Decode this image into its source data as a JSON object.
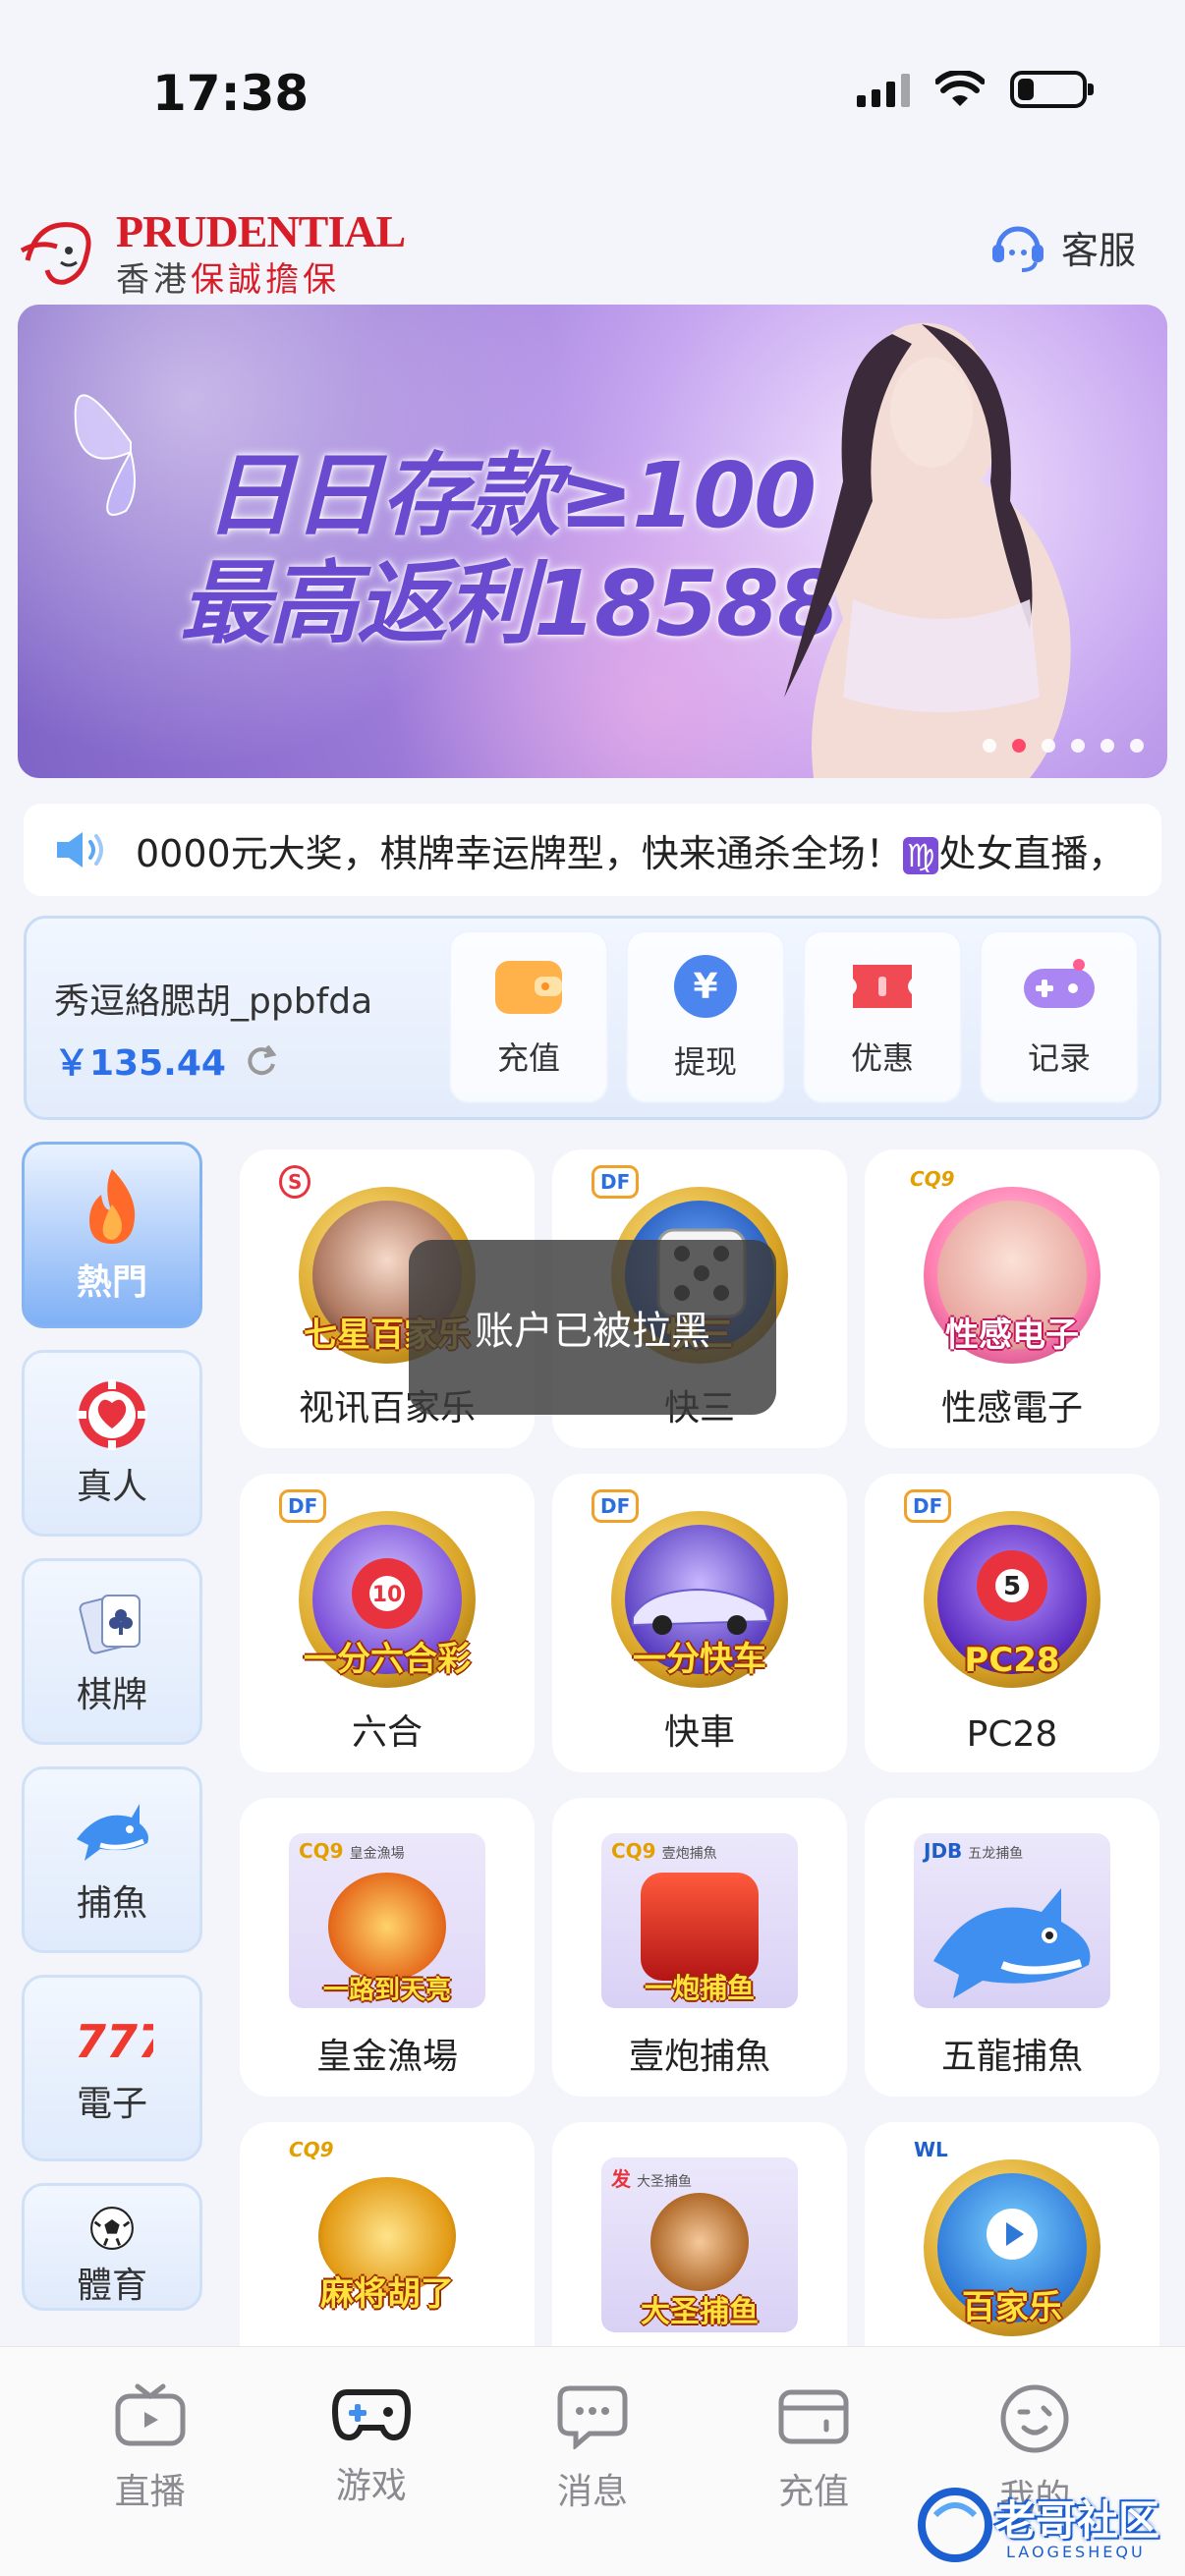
{
  "status_bar": {
    "time": "17:38"
  },
  "header": {
    "logo_brand": "PRUDENTIAL",
    "logo_sub_a": "香港",
    "logo_sub_b": "保誠擔保",
    "service_label": "客服"
  },
  "banner": {
    "line1": "日日存款≥100",
    "line2": "最高返利18588",
    "slide_count": 6,
    "active_slide": 2
  },
  "marquee": {
    "text": "0000元大奖，棋牌幸运牌型，快来通杀全场！",
    "virgo": "♍",
    "tail": "处女直播，"
  },
  "account": {
    "username": "秀逗絡腮胡_ppbfda",
    "balance": "￥135.44",
    "actions": [
      {
        "label": "充值",
        "icon": "wallet-icon"
      },
      {
        "label": "提现",
        "icon": "yuan-coin-icon"
      },
      {
        "label": "优惠",
        "icon": "ticket-icon"
      },
      {
        "label": "记录",
        "icon": "gamepad-icon"
      }
    ]
  },
  "side_nav": [
    {
      "label": "熱門",
      "icon": "flame-icon",
      "active": true
    },
    {
      "label": "真人",
      "icon": "poker-chip-icon",
      "active": false
    },
    {
      "label": "棋牌",
      "icon": "playing-cards-icon",
      "active": false
    },
    {
      "label": "捕魚",
      "icon": "shark-icon",
      "active": false
    },
    {
      "label": "電子",
      "icon": "slot-777-icon",
      "active": false
    },
    {
      "label": "體育",
      "icon": "soccer-ball-icon",
      "active": false
    }
  ],
  "games": [
    {
      "label": "视讯百家乐",
      "art_text": "七星百家乐",
      "badge": "S"
    },
    {
      "label": "快三",
      "art_text": "快三",
      "badge": "DF"
    },
    {
      "label": "性感電子",
      "art_text": "性感电子",
      "badge": "CQ9"
    },
    {
      "label": "六合",
      "art_text": "一分六合彩",
      "badge": "DF"
    },
    {
      "label": "快車",
      "art_text": "一分快车",
      "badge": "DF"
    },
    {
      "label": "PC28",
      "art_text": "PC28",
      "badge": "DF"
    },
    {
      "label": "皇金漁場",
      "art_text": "一路到天亮",
      "badge": "CQ9",
      "tag": "皇金漁場"
    },
    {
      "label": "壹炮捕魚",
      "art_text": "一炮捕鱼",
      "badge": "CQ9",
      "tag": "壹炮捕魚"
    },
    {
      "label": "五龍捕魚",
      "art_text": "",
      "badge": "JDB",
      "tag": "五龙捕鱼"
    },
    {
      "label": "",
      "art_text": "麻将胡了",
      "badge": "CQ9"
    },
    {
      "label": "",
      "art_text": "大圣捕鱼",
      "badge": "发",
      "tag": "大圣捕鱼"
    },
    {
      "label": "",
      "art_text": "百家乐",
      "badge": "WL"
    }
  ],
  "toast": {
    "text": "账户已被拉黑"
  },
  "tabbar": [
    {
      "label": "直播",
      "icon": "tv-icon"
    },
    {
      "label": "游戏",
      "icon": "gamepad-icon",
      "active": true
    },
    {
      "label": "消息",
      "icon": "chat-bubble-icon"
    },
    {
      "label": "充值",
      "icon": "wallet-card-icon"
    },
    {
      "label": "我的",
      "icon": "smiley-icon"
    }
  ],
  "watermark": {
    "text": "老哥社区",
    "sub": "LAOGESHEQU"
  },
  "colors": {
    "accent_blue": "#2d6fe8",
    "brand_red": "#d71e28",
    "toast_bg": "#3c3c3c"
  }
}
